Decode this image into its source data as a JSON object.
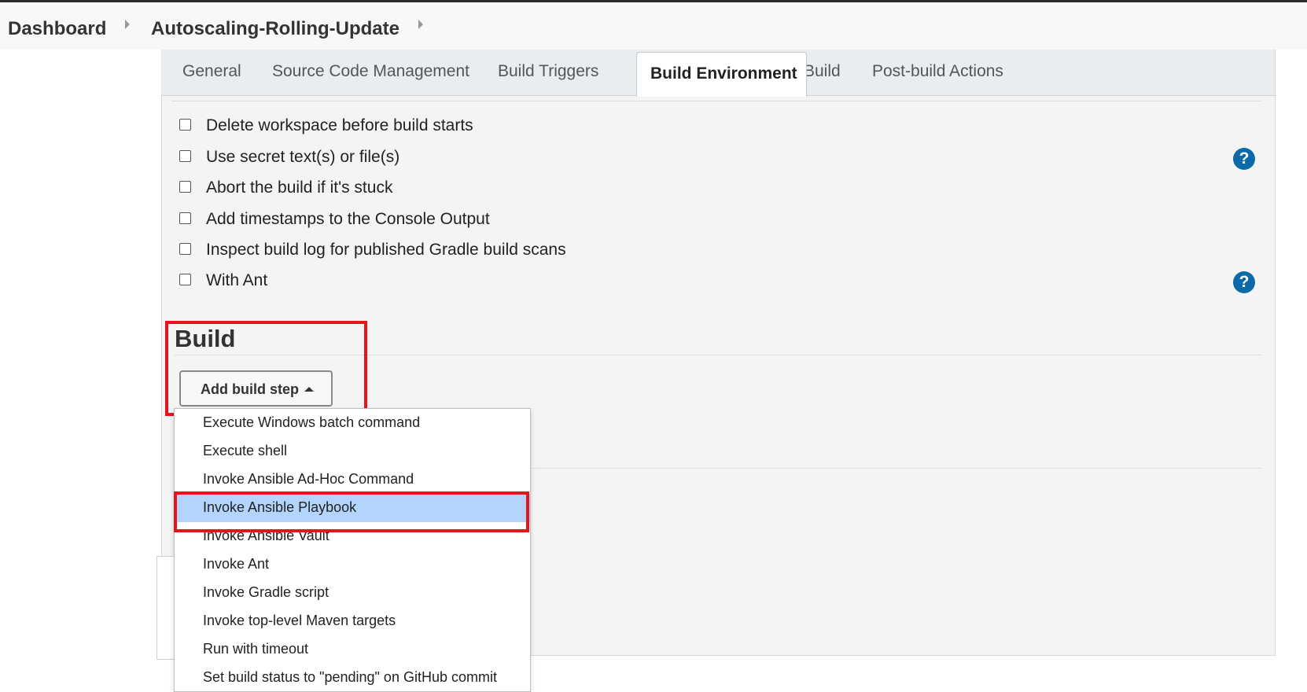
{
  "breadcrumb": {
    "items": [
      "Dashboard",
      "Autoscaling-Rolling-Update"
    ]
  },
  "tabs": [
    {
      "label": "General"
    },
    {
      "label": "Source Code Management"
    },
    {
      "label": "Build Triggers"
    },
    {
      "label": "Build Environment",
      "active": true
    },
    {
      "label": "Build"
    },
    {
      "label": "Post-build Actions"
    }
  ],
  "build_environment": {
    "options": [
      {
        "label": "Delete workspace before build starts",
        "checked": false
      },
      {
        "label": "Use secret text(s) or file(s)",
        "checked": false,
        "help": true
      },
      {
        "label": "Abort the build if it's stuck",
        "checked": false
      },
      {
        "label": "Add timestamps to the Console Output",
        "checked": false
      },
      {
        "label": "Inspect build log for published Gradle build scans",
        "checked": false
      },
      {
        "label": "With Ant",
        "checked": false,
        "help": true
      }
    ],
    "help_glyph": "?"
  },
  "build": {
    "heading": "Build",
    "add_step_label": "Add build step",
    "menu_items": [
      "Execute Windows batch command",
      "Execute shell",
      "Invoke Ansible Ad-Hoc Command",
      "Invoke Ansible Playbook",
      "Invoke Ansible Vault",
      "Invoke Ant",
      "Invoke Gradle script",
      "Invoke top-level Maven targets",
      "Run with timeout",
      "Set build status to \"pending\" on GitHub commit"
    ],
    "selected_item": "Invoke Ansible Playbook"
  },
  "colors": {
    "highlight_red": "#e8141b",
    "selection_blue": "#b3d4fc",
    "help_blue": "#0d6aa8"
  },
  "icons": [
    "chevron-right-icon",
    "help-icon",
    "caret-up-icon",
    "checkbox-icon"
  ]
}
